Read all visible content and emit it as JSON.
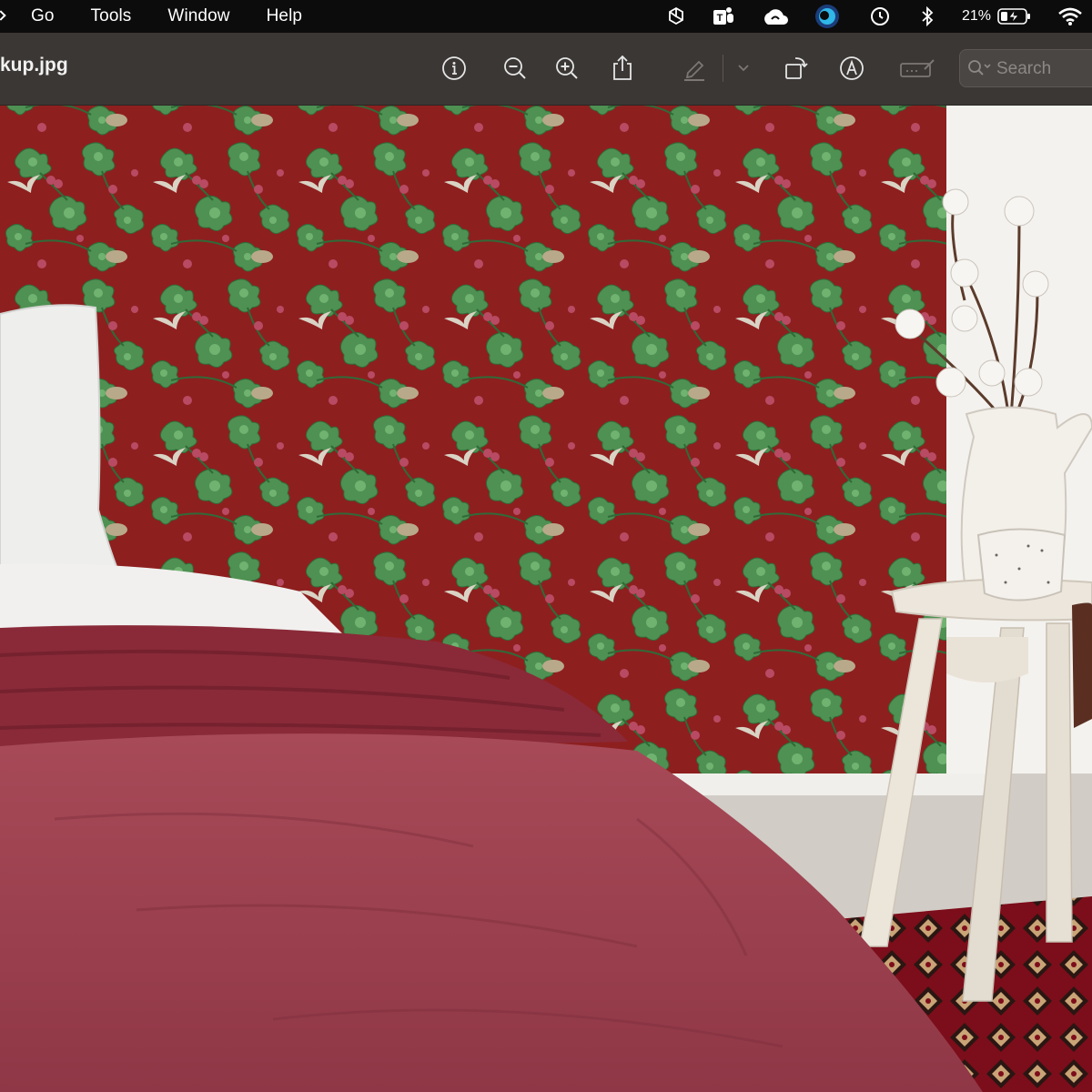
{
  "menubar": {
    "items": [
      "Go",
      "Tools",
      "Window",
      "Help"
    ],
    "battery_percent": "21%",
    "icons": [
      "chatgpt-icon",
      "teams-icon",
      "creative-cloud-icon",
      "app-icon",
      "time-machine-icon",
      "bluetooth-icon",
      "battery-icon",
      "wifi-icon"
    ]
  },
  "toolbar": {
    "title": "kup.jpg",
    "search_placeholder": "Search",
    "buttons": [
      "info-icon",
      "zoom-out-icon",
      "zoom-in-icon",
      "share-icon",
      "highlight-pen-icon",
      "chevron-down-icon",
      "rotate-icon",
      "markup-icon",
      "form-fill-icon"
    ]
  },
  "image": {
    "description_colors": {
      "wallpaper": "#8e1f1f",
      "leaf": "#4e9152",
      "duvet": "#9c4150",
      "wall": "#f1eeea",
      "rug": "#7c0d1a"
    }
  }
}
